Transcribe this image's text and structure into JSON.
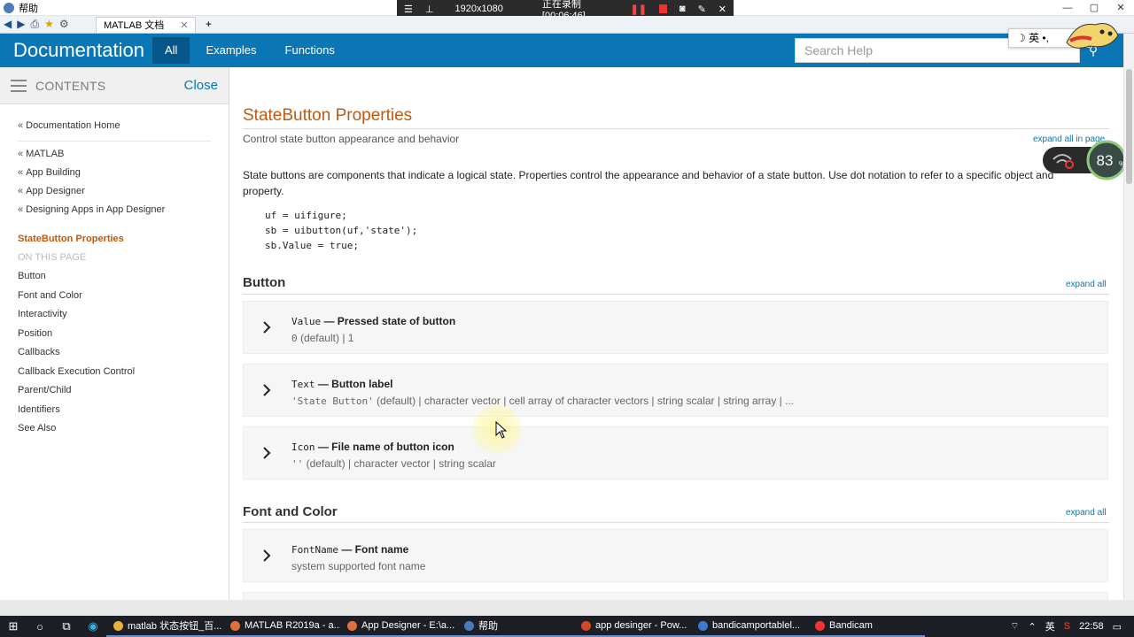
{
  "window": {
    "title": "帮助",
    "controls": [
      "—",
      "▢",
      "✕"
    ]
  },
  "recorder": {
    "resolution": "1920x1080",
    "status": "正在录制 [00:06:46]"
  },
  "tabbar": {
    "tab_label": "MATLAB 文档",
    "tab_close": "✕",
    "add": "+"
  },
  "header": {
    "brand": "Documentation",
    "tabs": [
      "All",
      "Examples",
      "Functions"
    ],
    "search_placeholder": "Search Help",
    "ime_text": "☽ 英 •,"
  },
  "sidebar": {
    "contents_label": "CONTENTS",
    "close_label": "Close",
    "breadcrumbs_top": [
      "Documentation Home"
    ],
    "breadcrumbs": [
      "MATLAB",
      "App Building",
      "App Designer",
      "Designing Apps in App Designer"
    ],
    "current": "StateButton Properties",
    "on_this_page": "ON THIS PAGE",
    "toc": [
      "Button",
      "Font and Color",
      "Interactivity",
      "Position",
      "Callbacks",
      "Callback Execution Control",
      "Parent/Child",
      "Identifiers",
      "See Also"
    ]
  },
  "main": {
    "title": "StateButton Properties",
    "subtitle": "Control state button appearance and behavior",
    "expand_all_page": "expand all in page",
    "description": "State buttons are components that indicate a logical state. Properties control the appearance and behavior of a state button. Use dot notation to refer to a specific object and property.",
    "code": [
      "uf = uifigure;",
      "sb = uibutton(uf,'state');",
      "sb.Value = true;"
    ],
    "sections": [
      {
        "title": "Button",
        "expand": "expand all",
        "props": [
          {
            "name": "Value",
            "desc": " — Pressed state of button",
            "vals_code": "0",
            "vals": " (default) | 1"
          },
          {
            "name": "Text",
            "desc": " — Button label",
            "vals_code": "'State Button'",
            "vals": " (default) | character vector | cell array of character vectors | string scalar | string array | ..."
          },
          {
            "name": "Icon",
            "desc": " — File name of button icon",
            "vals_code": "''",
            "vals": " (default) | character vector | string scalar"
          }
        ]
      },
      {
        "title": "Font and Color",
        "expand": "expand all",
        "props": [
          {
            "name": "FontName",
            "desc": " — Font name",
            "vals_code": "",
            "vals": "system supported font name"
          }
        ]
      }
    ]
  },
  "overlay": {
    "battery": "83",
    "battery_unit": "%"
  },
  "taskbar": {
    "items": [
      "matlab 状态按钮_百...",
      "MATLAB R2019a - a...",
      "App Designer - E:\\a...",
      "帮助",
      "app desinger - Pow...",
      "bandicamportablel...",
      "Bandicam"
    ],
    "tray_lang": "英",
    "clock": "22:58"
  },
  "colors": {
    "header_blue": "#0a76b3",
    "title_orange": "#c05a10",
    "link_blue": "#0a76b3"
  }
}
